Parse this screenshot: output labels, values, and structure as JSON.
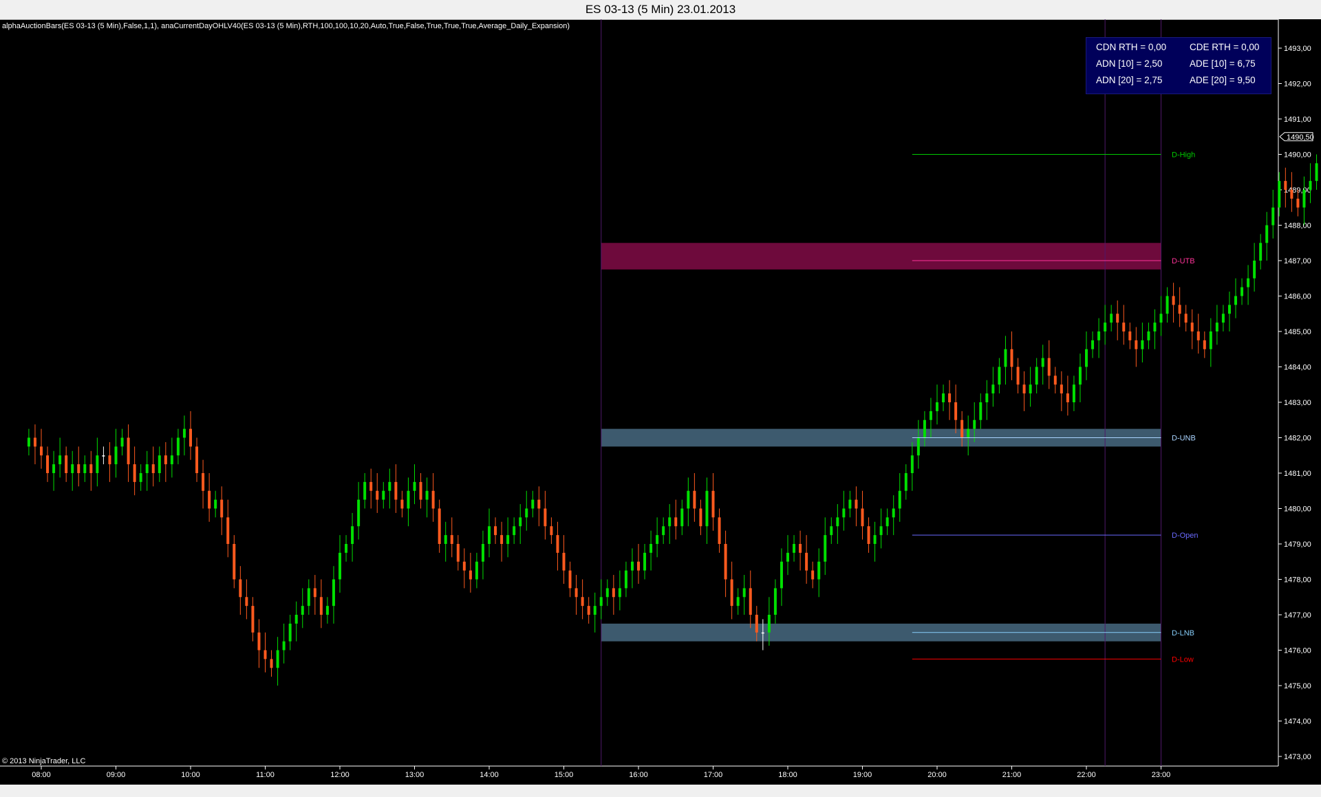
{
  "window": {
    "title": "ES 03-13 (5 Min)  23.01.2013"
  },
  "indicator_label": "alphaAuctionBars(ES 03-13 (5 Min),False,1,1), anaCurrentDayOHLV40(ES 03-13 (5 Min),RTH,100,100,10,20,Auto,True,False,True,True,True,Average_Daily_Expansion)",
  "copyright": "© 2013 NinjaTrader, LLC",
  "stats": {
    "cdn": "CDN RTH = 0,00",
    "cde": "CDE RTH = 0,00",
    "adn10": "ADN [10] = 2,50",
    "ade10": "ADE [10] = 6,75",
    "adn20": "ADN [20] = 2,75",
    "ade20": "ADE [20] = 9,50"
  },
  "colors": {
    "background": "#000000",
    "up_bar": "#00e000",
    "down_bar": "#ff5a1e",
    "doji_bar": "#ffffff",
    "upper_band": "#6e0a3c",
    "neutral_band": "#3d5a6e",
    "d_high": "#00cc00",
    "d_utb": "#ff3399",
    "d_unb": "#aad4ff",
    "d_open": "#6a6aff",
    "d_lnb": "#87cefa",
    "d_low": "#ff0000",
    "session_line": "#50186a"
  },
  "chart_data": {
    "type": "candlestick",
    "title": "ES 03-13 (5 Min)  23.01.2013",
    "y_range": [
      1472.75,
      1493.5
    ],
    "y_ticks": [
      "1473,00",
      "1474,00",
      "1475,00",
      "1476,00",
      "1477,00",
      "1478,00",
      "1479,00",
      "1480,00",
      "1481,00",
      "1482,00",
      "1483,00",
      "1484,00",
      "1485,00",
      "1486,00",
      "1487,00",
      "1488,00",
      "1489,00",
      "1490,00",
      "1491,00",
      "1492,00",
      "1493,00"
    ],
    "x_ticks": [
      "08:00",
      "09:00",
      "10:00",
      "11:00",
      "12:00",
      "13:00",
      "14:00",
      "15:00",
      "16:00",
      "17:00",
      "18:00",
      "19:00",
      "20:00",
      "21:00",
      "22:00",
      "23:00"
    ],
    "x_start": "07:50",
    "bar_minutes": 5,
    "last_price": "1490,50",
    "session_markers": [
      "15:30",
      "22:15",
      "23:00"
    ],
    "levels": [
      {
        "name": "D-High",
        "price": 1490.0,
        "color": "#00cc00"
      },
      {
        "name": "D-UTB",
        "price": 1487.0,
        "color": "#ff3399"
      },
      {
        "name": "D-UNB",
        "price": 1482.0,
        "color": "#aad4ff"
      },
      {
        "name": "D-Open",
        "price": 1479.25,
        "color": "#6a6aff"
      },
      {
        "name": "D-LNB",
        "price": 1476.5,
        "color": "#87cefa"
      },
      {
        "name": "D-Low",
        "price": 1475.75,
        "color": "#ff0000"
      }
    ],
    "bands": [
      {
        "from": 1486.75,
        "to": 1487.5,
        "color": "#6e0a3c"
      },
      {
        "from": 1481.75,
        "to": 1482.25,
        "color": "#3d5a6e"
      },
      {
        "from": 1476.25,
        "to": 1476.75,
        "color": "#3d5a6e"
      }
    ],
    "closes": [
      1482.0,
      1481.75,
      1481.5,
      1481.0,
      1481.25,
      1481.5,
      1481.0,
      1481.25,
      1481.0,
      1481.25,
      1481.0,
      1481.5,
      1481.5,
      1481.25,
      1481.75,
      1482.0,
      1481.25,
      1480.75,
      1481.0,
      1481.25,
      1481.0,
      1481.5,
      1481.25,
      1481.5,
      1482.0,
      1482.25,
      1481.75,
      1481.0,
      1480.5,
      1480.0,
      1480.25,
      1479.75,
      1479.0,
      1478.0,
      1477.5,
      1477.25,
      1476.5,
      1476.0,
      1475.75,
      1475.5,
      1476.0,
      1476.25,
      1476.75,
      1477.0,
      1477.25,
      1477.75,
      1477.5,
      1477.0,
      1477.25,
      1478.0,
      1478.75,
      1479.0,
      1479.5,
      1480.25,
      1480.75,
      1480.5,
      1480.25,
      1480.5,
      1480.75,
      1480.25,
      1480.0,
      1480.5,
      1480.75,
      1480.25,
      1480.5,
      1480.0,
      1479.0,
      1479.25,
      1479.0,
      1478.5,
      1478.25,
      1478.0,
      1478.5,
      1479.0,
      1479.5,
      1479.25,
      1479.0,
      1479.25,
      1479.5,
      1479.75,
      1480.0,
      1480.25,
      1480.0,
      1479.5,
      1479.25,
      1478.75,
      1478.25,
      1477.75,
      1477.5,
      1477.25,
      1477.0,
      1477.25,
      1477.5,
      1477.75,
      1477.5,
      1477.75,
      1478.25,
      1478.5,
      1478.25,
      1478.75,
      1479.0,
      1479.25,
      1479.5,
      1479.75,
      1479.5,
      1480.0,
      1480.5,
      1480.0,
      1479.5,
      1480.5,
      1479.75,
      1479.0,
      1478.0,
      1477.25,
      1477.5,
      1477.75,
      1477.0,
      1476.5,
      1476.5,
      1477.0,
      1477.75,
      1478.5,
      1478.75,
      1479.0,
      1478.75,
      1478.25,
      1478.0,
      1478.5,
      1479.25,
      1479.5,
      1479.75,
      1480.0,
      1480.25,
      1480.0,
      1479.5,
      1479.0,
      1479.25,
      1479.5,
      1479.75,
      1480.0,
      1480.5,
      1481.0,
      1481.5,
      1482.0,
      1482.5,
      1482.75,
      1483.0,
      1483.25,
      1483.0,
      1482.5,
      1482.0,
      1482.25,
      1482.5,
      1483.0,
      1483.25,
      1483.5,
      1484.0,
      1484.5,
      1484.0,
      1483.5,
      1483.25,
      1483.5,
      1484.0,
      1484.25,
      1483.75,
      1483.5,
      1483.25,
      1483.0,
      1483.5,
      1484.0,
      1484.5,
      1484.75,
      1485.0,
      1485.25,
      1485.5,
      1485.25,
      1485.0,
      1484.75,
      1484.5,
      1484.75,
      1485.0,
      1485.25,
      1485.5,
      1486.0,
      1485.75,
      1485.5,
      1485.25,
      1485.0,
      1484.75,
      1484.5,
      1485.0,
      1485.25,
      1485.5,
      1485.75,
      1486.0,
      1486.25,
      1486.5,
      1487.0,
      1487.5,
      1488.0,
      1488.5,
      1489.25,
      1489.0,
      1488.75,
      1488.5,
      1489.0,
      1489.25,
      1489.75,
      1490.25,
      1490.75,
      1491.25,
      1490.5,
      1490.75,
      1490.5
    ],
    "x_axis_label": "",
    "y_axis_label": ""
  }
}
